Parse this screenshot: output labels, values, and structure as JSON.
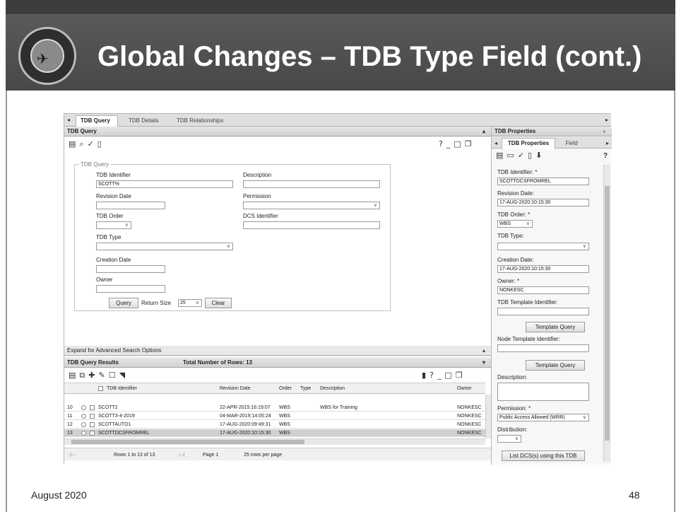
{
  "slide": {
    "title": "Global Changes – TDB Type Field (cont.)",
    "date": "August 2020",
    "page_number": "48"
  },
  "app": {
    "tabs": [
      "TDB Query",
      "TDB Details",
      "TDB Relationships"
    ],
    "query_section_title": "TDB Query",
    "fieldset_legend": "TDB Query",
    "fields": {
      "tdb_identifier_label": "TDB Identifier",
      "tdb_identifier_value": "SCOTT%",
      "description_label": "Description",
      "revision_date_label": "Revision Date",
      "permission_label": "Permission",
      "tdb_order_label": "TDB Order",
      "dcs_identifier_label": "DCS Identifier",
      "tdb_type_label": "TDB Type",
      "creation_date_label": "Creation Date",
      "owner_label": "Owner"
    },
    "query_button": "Query",
    "return_size_label": "Return Size",
    "return_size_value": "25",
    "clear_button": "Clear",
    "advanced_search": "Expand for Advanced Search Options",
    "results_title": "TDB Query Results",
    "total_rows": "Total Number of Rows: 13",
    "columns": [
      "TDB Identifier",
      "Revision Date",
      "Order",
      "Type",
      "Description",
      "Owner"
    ],
    "rows": [
      {
        "num": "10",
        "id": "SCOTT2",
        "revdate": "22-APR-2015:16:19:07",
        "order": "WBS",
        "type": "",
        "desc": "WBS for Training",
        "owner": "NONKESC"
      },
      {
        "num": "11",
        "id": "SCOTT3-4-2019",
        "revdate": "04-MAR-2019:14:05:24",
        "order": "WBS",
        "type": "",
        "desc": "",
        "owner": "NONKESC"
      },
      {
        "num": "12",
        "id": "SCOTTAUTO1",
        "revdate": "17-AUG-2020:09:49:31",
        "order": "WBS",
        "type": "",
        "desc": "",
        "owner": "NONKESC"
      },
      {
        "num": "13",
        "id": "SCOTTDCSFROMREL",
        "revdate": "17-AUG-2020:10:15:30",
        "order": "WBS",
        "type": "",
        "desc": "",
        "owner": "NONKESC"
      }
    ],
    "pager": {
      "rows_label": "Rows 1 to 13 of 13",
      "page_label": "Page 1",
      "per_page_label": "25 rows per page"
    },
    "icon_help": "?"
  },
  "props": {
    "title": "TDB Properties",
    "tabs": [
      "TDB Properties",
      "Field"
    ],
    "tdb_identifier_label": "TDB Identifier: *",
    "tdb_identifier_value": "SCOTTDCSFROMREL",
    "revision_date_label": "Revision Date:",
    "revision_date_value": "17-AUG-2020:10:15:30",
    "tdb_order_label": "TDB Order: *",
    "tdb_order_value": "WBS",
    "tdb_type_label": "TDB Type:",
    "creation_date_label": "Creation Date:",
    "creation_date_value": "17-AUG-2020:10:15:30",
    "owner_label": "Owner: *",
    "owner_value": "NONKESC",
    "template_id_label": "TDB Template Identifier:",
    "template_query_button": "Template Query",
    "node_template_label": "Node Template Identifier:",
    "template_query_button_2": "Template Query",
    "description_label": "Description:",
    "permission_label": "Permission: *",
    "permission_value": "Public Access Allowed (WRR)",
    "distribution_label": "Distribution:",
    "list_dcs_button": "List DCS(s) using this TDB"
  }
}
